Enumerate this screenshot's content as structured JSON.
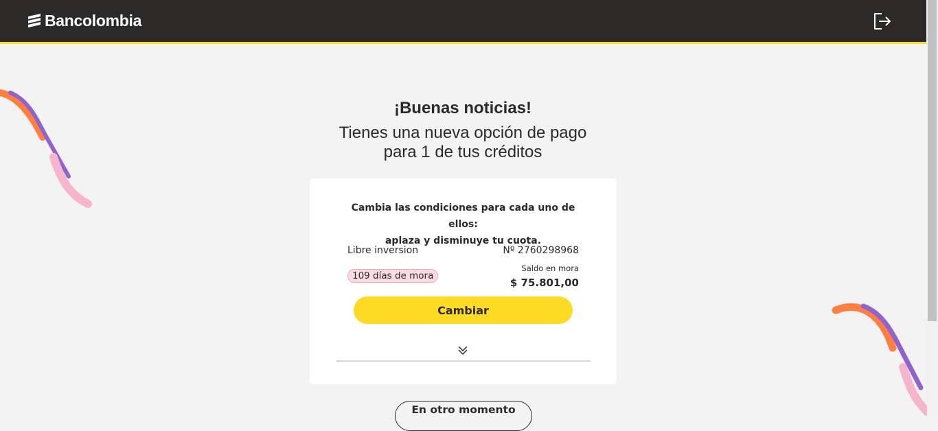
{
  "header": {
    "brand": "Bancolombia",
    "exit_icon": "logout-icon"
  },
  "main": {
    "title": "¡Buenas noticias!",
    "subtitle_line1": "Tienes una nueva opción de pago",
    "subtitle_line2": "para 1 de tus créditos"
  },
  "card": {
    "heading_line1": "Cambia las condiciones para cada uno de ellos:",
    "heading_line2": "aplaza y disminuye tu cuota.",
    "credit": {
      "name": "Libre inversion",
      "number": "Nº 2760298968",
      "mora_badge": "109 días de mora",
      "saldo_label": "Saldo en mora",
      "saldo_value": "$ 75.801,00"
    },
    "change_label": "Cambiar",
    "expand_icon": "double-chevron-down-icon"
  },
  "footer": {
    "later_label": "En otro momento"
  },
  "colors": {
    "header_bg": "#2c2a29",
    "accent_yellow": "#fdda24",
    "orange": "#ff7f41",
    "purple": "#9063cd",
    "pink": "#f5b6cd",
    "page_bg": "#f3f3f3"
  }
}
